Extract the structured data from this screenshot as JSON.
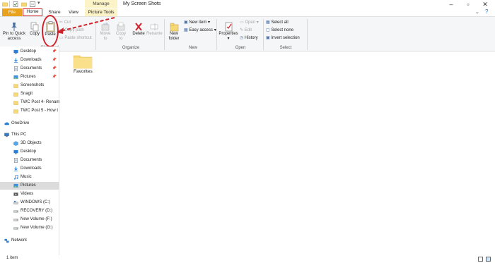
{
  "titlebar": {
    "manage_tab": "Manage",
    "window_title": "My Screen Shots"
  },
  "tabs": {
    "file": "File",
    "home": "Home",
    "share": "Share",
    "view": "View",
    "picture_tools": "Picture Tools"
  },
  "ribbon": {
    "clipboard": {
      "pin_line1": "Pin to Quick",
      "pin_line2": "access",
      "copy": "Copy",
      "paste": "Paste",
      "cut": "Cut",
      "copy_path": "Copy path",
      "paste_shortcut": "Paste shortcut",
      "group_label": "Clipboard"
    },
    "organize": {
      "move_line1": "Move",
      "move_line2": "to",
      "copy_line1": "Copy",
      "copy_line2": "to",
      "delete": "Delete",
      "rename": "Rename",
      "group_label": "Organize"
    },
    "new": {
      "new_folder_line1": "New",
      "new_folder_line2": "folder",
      "new_item": "New item",
      "easy_access": "Easy access",
      "group_label": "New"
    },
    "open": {
      "properties": "Properties",
      "open": "Open",
      "edit": "Edit",
      "history": "History",
      "group_label": "Open"
    },
    "select": {
      "select_all": "Select all",
      "select_none": "Select none",
      "invert_selection": "Invert selection",
      "group_label": "Select"
    }
  },
  "nav": {
    "quick_access": [
      {
        "label": "Desktop",
        "pinned": true
      },
      {
        "label": "Downloads",
        "pinned": true
      },
      {
        "label": "Documents",
        "pinned": true
      },
      {
        "label": "Pictures",
        "pinned": true
      },
      {
        "label": "Screenshots",
        "pinned": false
      },
      {
        "label": "Snagit",
        "pinned": false
      },
      {
        "label": "TWC Post 4- Renam",
        "pinned": false
      },
      {
        "label": "TWC Post 5 - How t",
        "pinned": false
      }
    ],
    "onedrive": "OneDrive",
    "this_pc": "This PC",
    "pc_items": [
      "3D Objects",
      "Desktop",
      "Documents",
      "Downloads",
      "Music",
      "Pictures",
      "Videos",
      "WINDOWS (C:)",
      "RECOVERY (D:)",
      "New Volume (F:)",
      "New Volume (G:)"
    ],
    "network": "Network"
  },
  "content": {
    "folder_label": "Favorites"
  },
  "status": {
    "item_count": "1 item"
  },
  "colors": {
    "file_tab": "#e8a21d",
    "annotation_red": "#d0202a",
    "folder_yellow": "#f8d775",
    "selected_nav": "#dcdcdc"
  }
}
